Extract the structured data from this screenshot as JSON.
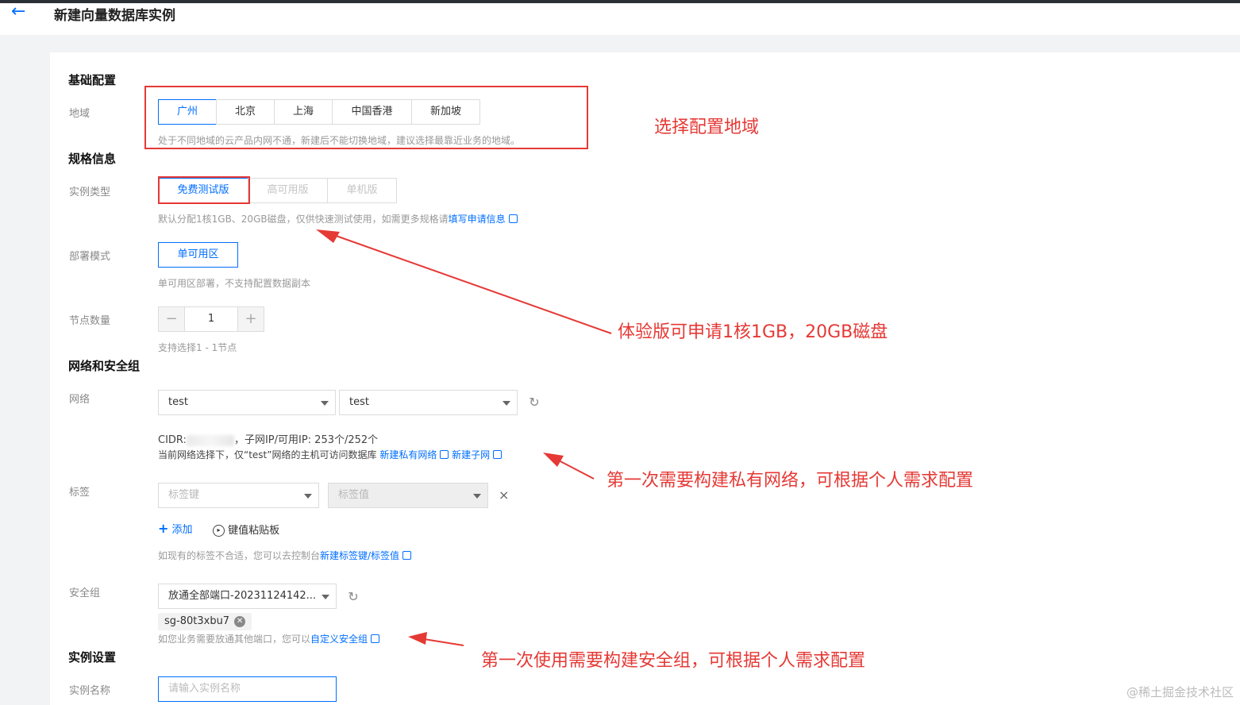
{
  "header": {
    "title": "新建向量数据库实例"
  },
  "basic": {
    "section_title": "基础配置",
    "region_label": "地域",
    "regions": [
      "广州",
      "北京",
      "上海",
      "中国香港",
      "新加坡"
    ],
    "region_selected": "广州",
    "region_hint": "处于不同地域的云产品内网不通，新建后不能切换地域，建议选择最靠近业务的地域。"
  },
  "spec": {
    "section_title": "规格信息",
    "type_label": "实例类型",
    "types": [
      "免费测试版",
      "高可用版",
      "单机版"
    ],
    "type_selected": "免费测试版",
    "type_hint": "默认分配1核1GB、20GB磁盘，仅供快速测试使用，如需更多规格请",
    "type_hint_link": "填写申请信息",
    "deploy_label": "部署模式",
    "deploy_value": "单可用区",
    "deploy_hint": "单可用区部署，不支持配置数据副本",
    "nodes_label": "节点数量",
    "nodes_value": "1",
    "nodes_minus": "−",
    "nodes_plus": "+",
    "nodes_hint": "支持选择1 - 1节点"
  },
  "network": {
    "section_title": "网络和安全组",
    "net_label": "网络",
    "vpc_value": "test",
    "subnet_value": "test",
    "cidr_prefix": "CIDR:",
    "cidr_suffix": "，子网IP/可用IP: 253个/252个",
    "access_hint": "当前网络选择下，仅“test”网络的主机可访问数据库",
    "new_vpc_link": "新建私有网络",
    "new_subnet_link": "新建子网",
    "tag_label": "标签",
    "tag_key_placeholder": "标签键",
    "tag_value_placeholder": "标签值",
    "tag_remove": "×",
    "add_label": "添加",
    "add_icon": "+",
    "paste_label": "键值粘贴板",
    "tag_hint": "如现有的标签不合适，您可以去控制台",
    "tag_hint_link": "新建标签键/标签值",
    "sg_label": "安全组",
    "sg_value": "放通全部端口-20231124142...",
    "sg_chip": "sg-80t3xbu7",
    "sg_hint": "如您业务需要放通其他端口，您可以",
    "sg_hint_link": "自定义安全组"
  },
  "instance": {
    "section_title": "实例设置",
    "name_label": "实例名称",
    "name_placeholder": "请输入实例名称"
  },
  "annotations": {
    "region": "选择配置地域",
    "spec": "体验版可申请1核1GB，20GB磁盘",
    "network": "第一次需要构建私有网络，可根据个人需求配置",
    "security": "第一次使用需要构建安全组，可根据个人需求配置"
  },
  "watermark": "@稀土掘金技术社区",
  "colors": {
    "accent": "#006eff",
    "annotation": "#e53935"
  }
}
